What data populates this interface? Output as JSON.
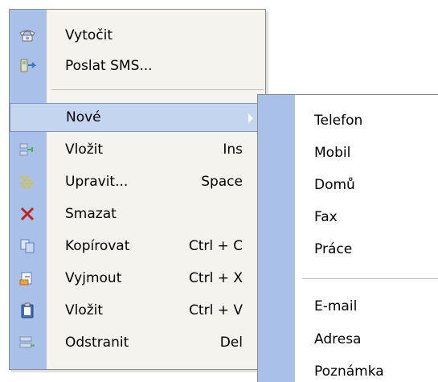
{
  "menu": {
    "items": [
      {
        "label": "Vytočit",
        "icon": "phone-icon",
        "shortcut": ""
      },
      {
        "label": "Poslat SMS...",
        "icon": "sms-icon",
        "shortcut": ""
      },
      {
        "label": "Nové",
        "icon": "",
        "shortcut": "",
        "has_submenu": true,
        "highlighted": true
      },
      {
        "label": "Vložit",
        "icon": "insert-icon",
        "shortcut": "Ins"
      },
      {
        "label": "Upravit...",
        "icon": "edit-icon",
        "shortcut": "Space"
      },
      {
        "label": "Smazat",
        "icon": "delete-icon",
        "shortcut": ""
      },
      {
        "label": "Kopírovat",
        "icon": "copy-icon",
        "shortcut": "Ctrl + C"
      },
      {
        "label": "Vyjmout",
        "icon": "cut-icon",
        "shortcut": "Ctrl + X"
      },
      {
        "label": "Vložit",
        "icon": "paste-icon",
        "shortcut": "Ctrl + V"
      },
      {
        "label": "Odstranit",
        "icon": "remove-icon",
        "shortcut": "Del"
      }
    ]
  },
  "submenu": {
    "items": [
      {
        "label": "Telefon"
      },
      {
        "label": "Mobil"
      },
      {
        "label": "Domů"
      },
      {
        "label": "Fax"
      },
      {
        "label": "Práce"
      },
      {
        "label": "E-mail"
      },
      {
        "label": "Adresa"
      },
      {
        "label": "Poznámka"
      }
    ]
  },
  "colors": {
    "icon_strip": "#a9c1e8",
    "highlight": "#c3d5ef",
    "menu_background": "#f4f3ee",
    "submenu_background": "#ffffff"
  }
}
